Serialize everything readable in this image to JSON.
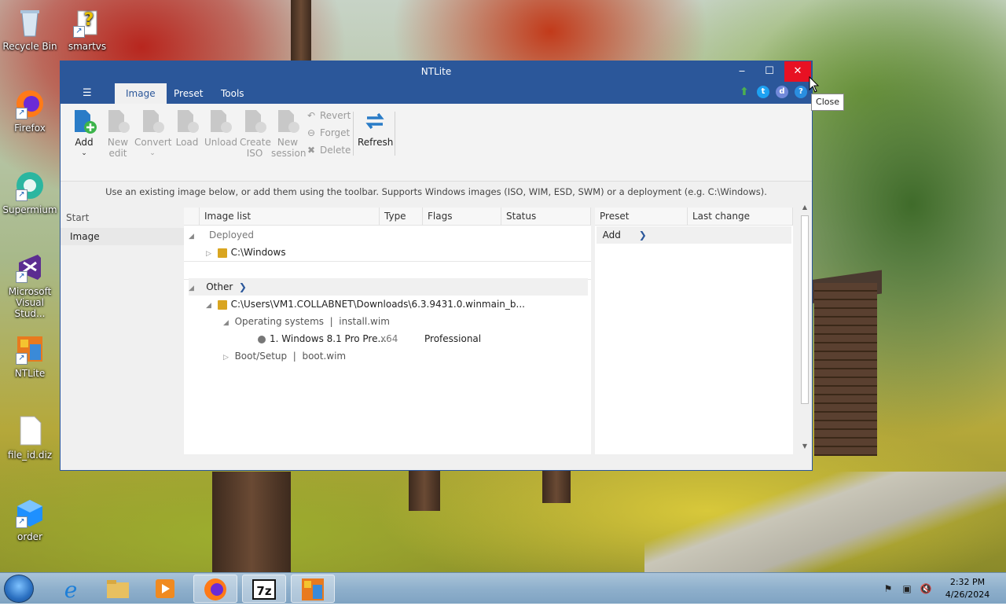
{
  "desktop": {
    "icons": [
      {
        "label": "Recycle Bin",
        "icon": "recycle-bin-icon"
      },
      {
        "label": "smartvs",
        "icon": "document-question-icon"
      },
      {
        "label": "Firefox",
        "icon": "firefox-icon"
      },
      {
        "label": "Supermium",
        "icon": "supermium-icon"
      },
      {
        "label": "Microsoft Visual Stud...",
        "icon": "visual-studio-icon"
      },
      {
        "label": "NTLite",
        "icon": "ntlite-icon"
      },
      {
        "label": "file_id.diz",
        "icon": "file-icon"
      },
      {
        "label": "order",
        "icon": "cube-icon"
      }
    ]
  },
  "window": {
    "title": "NTLite",
    "tabs": [
      "Image",
      "Preset",
      "Tools"
    ],
    "active_tab": "Image",
    "tooltip": "Close",
    "header_icons": [
      "update-arrow-icon",
      "twitter-icon",
      "discord-icon",
      "help-icon"
    ],
    "accent": "#2b579a",
    "close_color": "#e81123"
  },
  "ribbon": {
    "add": "Add",
    "new_edit": [
      "New",
      "edit"
    ],
    "convert": "Convert",
    "load": "Load",
    "unload": "Unload",
    "create_iso": [
      "Create",
      "ISO"
    ],
    "new_session": [
      "New",
      "session"
    ],
    "revert": "Revert",
    "forget": "Forget",
    "delete": "Delete",
    "refresh": "Refresh"
  },
  "hint": "Use an existing image below, or add them using the toolbar. Supports Windows images (ISO, WIM, ESD, SWM) or a deployment (e.g. C:\\Windows).",
  "leftnav": {
    "header": "Start",
    "item": "Image"
  },
  "image_list": {
    "columns": [
      "Image list",
      "Type",
      "Flags",
      "Status"
    ],
    "deployed_group": "Deployed",
    "deployed_item": "C:\\Windows",
    "other_group": "Other",
    "source_path": "C:\\Users\\VM1.COLLABNET\\Downloads\\6.3.9431.0.winmain_b...",
    "os_node": "Operating systems  |  install.wim",
    "edition": "1. Windows 8.1 Pro Pre...",
    "edition_type": "x64",
    "edition_flags": "Professional",
    "boot_node": "Boot/Setup  |  boot.wim"
  },
  "preset_list": {
    "columns": [
      "Preset",
      "Last change"
    ],
    "add": "Add"
  },
  "taskbar": {
    "time": "2:32 PM",
    "date": "4/26/2024",
    "apps": [
      "internet-explorer-icon",
      "file-explorer-icon",
      "media-player-icon",
      "firefox-icon",
      "7zip-icon",
      "ntlite-icon"
    ]
  }
}
